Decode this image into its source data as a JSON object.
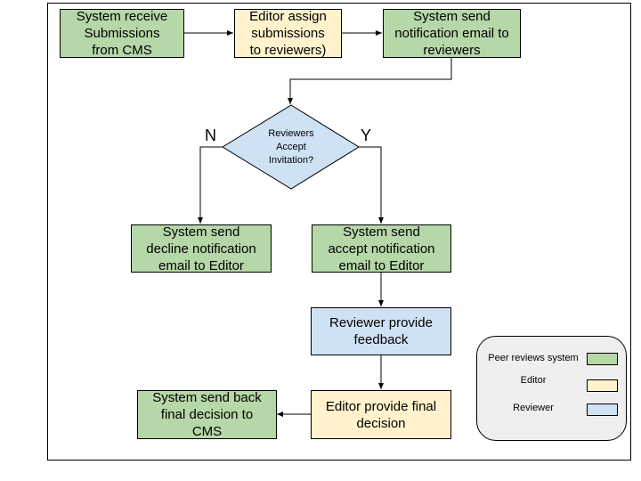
{
  "nodes": {
    "receive": "System receive\nSubmissions\nfrom CMS",
    "assign": "Editor assign\nsubmissions\nto reviewers)",
    "notify": "System send\nnotification email to\nreviewers",
    "decision": "Reviewers\nAccept\nInvitation?",
    "decline": "System send\ndecline notification\nemail to Editor",
    "accept": "System send\naccept notification\nemail to Editor",
    "feedback": "Reviewer provide\nfeedback",
    "final": "Editor provide final\ndecision",
    "back": "System send  back\nfinal decision to\nCMS"
  },
  "branches": {
    "no": "N",
    "yes": "Y"
  },
  "legend": {
    "items": [
      {
        "label": "Peer reviews system",
        "color": "#b6d7a8"
      },
      {
        "label": "Editor",
        "color": "#fff2cc"
      },
      {
        "label": "Reviewer",
        "color": "#cfe2f3"
      }
    ]
  }
}
